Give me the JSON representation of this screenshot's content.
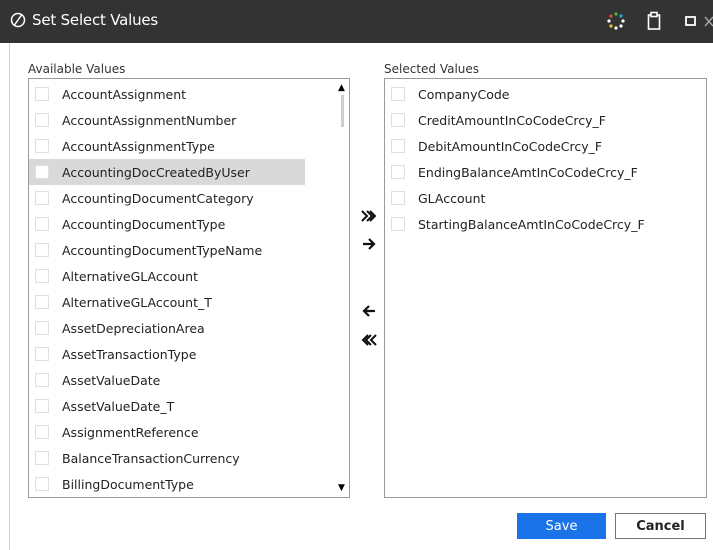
{
  "dialog": {
    "title": "Set Select Values"
  },
  "available": {
    "label": "Available Values",
    "items": [
      "AccountAssignment",
      "AccountAssignmentNumber",
      "AccountAssignmentType",
      "AccountingDocCreatedByUser",
      "AccountingDocumentCategory",
      "AccountingDocumentType",
      "AccountingDocumentTypeName",
      "AlternativeGLAccount",
      "AlternativeGLAccount_T",
      "AssetDepreciationArea",
      "AssetTransactionType",
      "AssetValueDate",
      "AssetValueDate_T",
      "AssignmentReference",
      "BalanceTransactionCurrency",
      "BillingDocumentType"
    ],
    "highlighted_item": "AccountingDocCreatedByUser"
  },
  "selected": {
    "label": "Selected Values",
    "items": [
      "CompanyCode",
      "CreditAmountInCoCodeCrcy_F",
      "DebitAmountInCoCodeCrcy_F",
      "EndingBalanceAmtInCoCodeCrcy_F",
      "GLAccount",
      "StartingBalanceAmtInCoCodeCrcy_F"
    ]
  },
  "buttons": {
    "save": "Save",
    "cancel": "Cancel"
  },
  "icons": {
    "title_logo": "circle-slash-logo-icon",
    "loading": "loading-dots-icon",
    "clipboard": "clipboard-icon",
    "maximize": "maximize-icon",
    "move_all_right": "double-arrow-right-icon",
    "move_right": "arrow-right-icon",
    "move_left": "arrow-left-icon",
    "move_all_left": "double-arrow-left-icon"
  },
  "colors": {
    "titlebar": "#333333",
    "primary": "#1a73e8",
    "highlight": "#d9d9d9"
  }
}
